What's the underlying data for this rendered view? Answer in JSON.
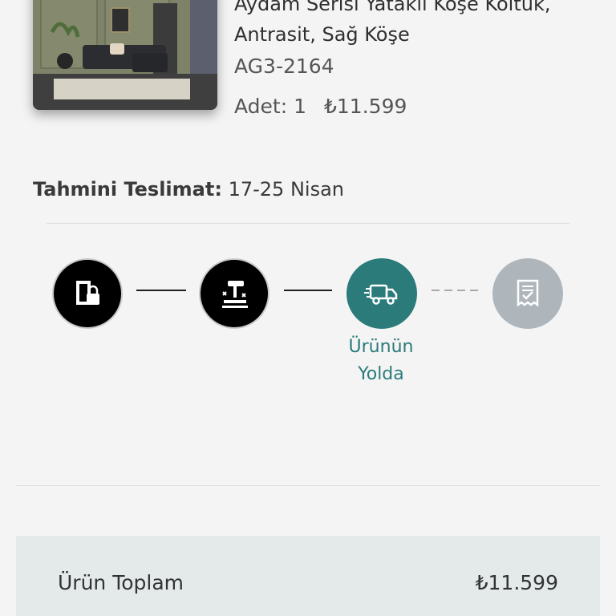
{
  "product": {
    "title_line1": "Aydam Serisi Yataklı Köşe Koltuk,",
    "title_line2": "Antrasit, Sağ Köşe",
    "sku": "AG3-2164",
    "qty_label": "Adet: 1",
    "price": "₺11.599"
  },
  "delivery": {
    "label": "Tahmini Teslimat:",
    "value": "17-25 Nisan"
  },
  "tracker": {
    "steps": [
      {
        "icon": "door-lock-icon",
        "status": "done"
      },
      {
        "icon": "craftsman-hammer-icon",
        "status": "done"
      },
      {
        "icon": "delivery-truck-icon",
        "status": "active"
      },
      {
        "icon": "receipt-check-icon",
        "status": "pending"
      }
    ],
    "active_label_line1": "Ürünün",
    "active_label_line2": "Yolda",
    "colors": {
      "done": "#000000",
      "active": "#2b7b7b",
      "pending": "#aeb6bb"
    }
  },
  "summary": {
    "label": "Ürün Toplam",
    "value": "₺11.599"
  }
}
